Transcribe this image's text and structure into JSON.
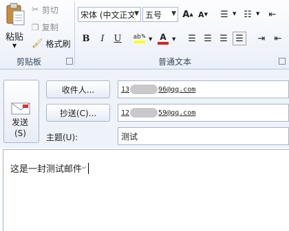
{
  "clipboard": {
    "paste_label": "粘贴",
    "cut_label": "剪切",
    "copy_label": "复制",
    "format_painter_label": "格式刷",
    "group_label": "剪贴板"
  },
  "font": {
    "font_name": "宋体 (中文正文",
    "font_size": "五号",
    "group_label": "普通文本"
  },
  "compose": {
    "send_label": "发送",
    "send_shortcut": "(S)",
    "to_button": "收件人...",
    "cc_button": "抄送(C)...",
    "subject_label": "主题(U):",
    "to_prefix": "13",
    "to_suffix": "96@qq.com",
    "cc_prefix": "12",
    "cc_suffix": "59@qq.com",
    "subject_value": "测试",
    "body_text": "这是一封测试邮件"
  },
  "colors": {
    "highlight": "#ffff00",
    "font_color": "#e02020",
    "accent": "#2b5797"
  }
}
